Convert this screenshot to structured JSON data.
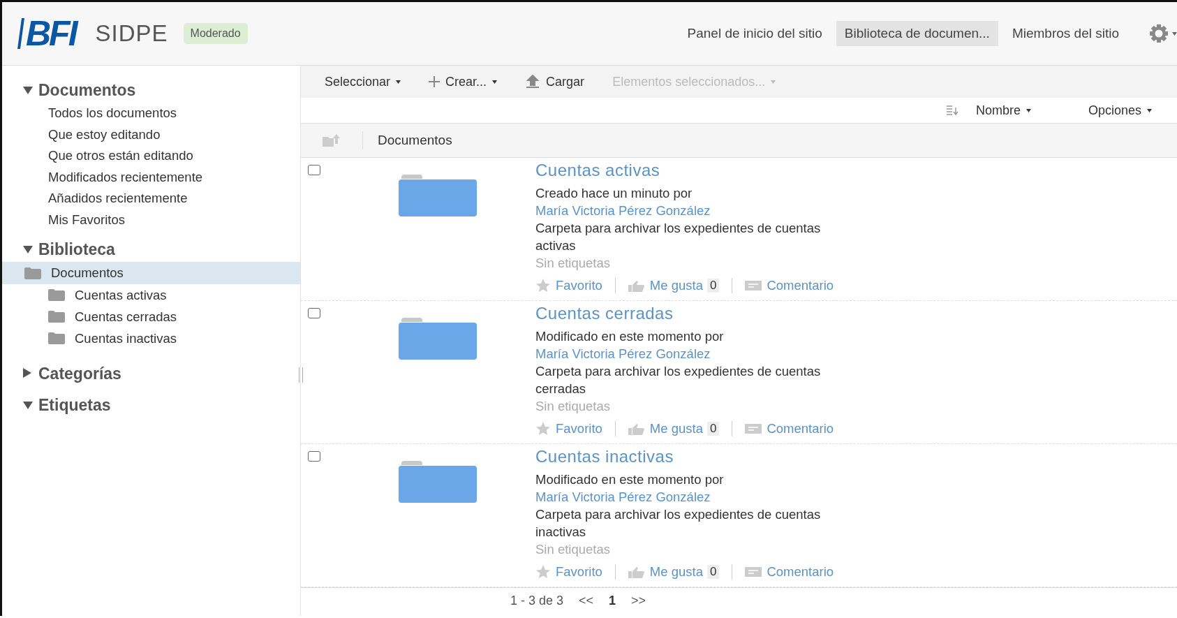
{
  "header": {
    "logo_text": "BFI",
    "site_title": "SIDPE",
    "badge": "Moderado",
    "nav": [
      {
        "label": "Panel de inicio del sitio",
        "selected": false
      },
      {
        "label": "Biblioteca de documen...",
        "selected": true
      },
      {
        "label": "Miembros del sitio",
        "selected": false
      }
    ]
  },
  "sidebar": {
    "sections": [
      {
        "title": "Documentos",
        "expanded": true,
        "kind": "links",
        "items": [
          {
            "label": "Todos los documentos"
          },
          {
            "label": "Que estoy editando"
          },
          {
            "label": "Que otros están editando"
          },
          {
            "label": "Modificados recientemente"
          },
          {
            "label": "Añadidos recientemente"
          },
          {
            "label": "Mis Favoritos"
          }
        ]
      },
      {
        "title": "Biblioteca",
        "expanded": true,
        "kind": "tree",
        "items": [
          {
            "label": "Documentos",
            "selected": true,
            "children": [
              {
                "label": "Cuentas activas",
                "selected": false
              },
              {
                "label": "Cuentas cerradas",
                "selected": false
              },
              {
                "label": "Cuentas inactivas",
                "selected": false
              }
            ]
          }
        ]
      },
      {
        "title": "Categorías",
        "expanded": false
      },
      {
        "title": "Etiquetas",
        "expanded": true
      }
    ]
  },
  "toolbar": {
    "buttons": [
      {
        "label": "Seleccionar",
        "kind": "dropdown",
        "disabled": false
      },
      {
        "label": "Crear...",
        "kind": "create",
        "disabled": false
      },
      {
        "label": "Cargar",
        "kind": "upload",
        "disabled": false
      },
      {
        "label": "Elementos seleccionados...",
        "kind": "dropdown",
        "disabled": true
      }
    ],
    "sort": "Nombre",
    "options": "Opciones"
  },
  "breadcrumb": "Documentos",
  "items": [
    {
      "checked": false,
      "title": "Cuentas activas",
      "meta": "Creado hace un minuto por",
      "author": "María Victoria Pérez González",
      "description": "Carpeta para archivar los expedientes de cuentas activas",
      "tags": "Sin etiquetas",
      "favorite": "Favorito",
      "like": "Me gusta",
      "like_count": "0",
      "comment": "Comentario"
    },
    {
      "checked": false,
      "title": "Cuentas cerradas",
      "meta": "Modificado en este momento por",
      "author": "María Victoria Pérez González",
      "description": "Carpeta para archivar los expedientes de cuentas cerradas",
      "tags": "Sin etiquetas",
      "favorite": "Favorito",
      "like": "Me gusta",
      "like_count": "0",
      "comment": "Comentario"
    },
    {
      "checked": false,
      "title": "Cuentas inactivas",
      "meta": "Modificado en este momento por",
      "author": "María Victoria Pérez González",
      "description": "Carpeta para archivar los expedientes de cuentas inactivas",
      "tags": "Sin etiquetas",
      "favorite": "Favorito",
      "like": "Me gusta",
      "like_count": "0",
      "comment": "Comentario"
    }
  ],
  "pagination": {
    "summary": "1 - 3 de 3",
    "first": "<<",
    "page": "1",
    "last": ">>"
  }
}
